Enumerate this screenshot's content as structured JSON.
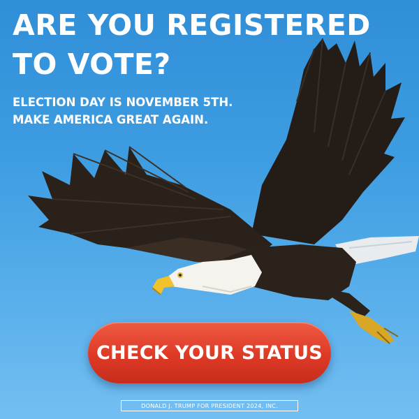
{
  "headline": {
    "line1": "ARE YOU REGISTERED",
    "line2": "TO VOTE?"
  },
  "subline": {
    "line1": "ELECTION DAY IS NOVEMBER 5TH.",
    "line2": "MAKE AMERICA GREAT AGAIN."
  },
  "cta": {
    "label": "CHECK YOUR STATUS"
  },
  "disclaimer": {
    "text": "DONALD J. TRUMP FOR PRESIDENT 2024, INC."
  },
  "colors": {
    "sky": "#3f9ee2",
    "cta": "#de3a26",
    "text": "#ffffff"
  },
  "image": {
    "icon": "bald-eagle-illustration"
  }
}
